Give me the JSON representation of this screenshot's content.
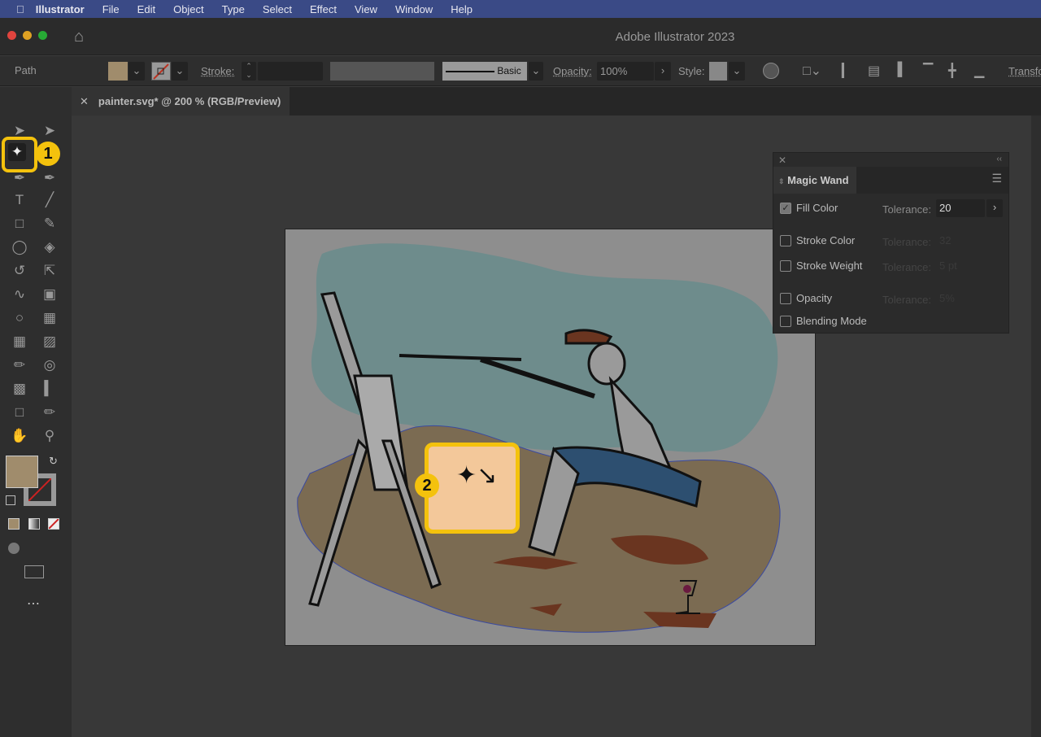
{
  "menubar": {
    "app": "Illustrator",
    "items": [
      "File",
      "Edit",
      "Object",
      "Type",
      "Select",
      "Effect",
      "View",
      "Window",
      "Help"
    ]
  },
  "window": {
    "title": "Adobe Illustrator 2023"
  },
  "control_bar": {
    "selection": "Path",
    "stroke_label": "Stroke:",
    "style_preset": "Basic",
    "opacity_label": "Opacity:",
    "opacity_value": "100%",
    "style_label": "Style:",
    "transform_label": "Transfo"
  },
  "document_tab": {
    "title": "painter.svg* @ 200 % (RGB/Preview)"
  },
  "magic_wand_panel": {
    "title": "Magic Wand",
    "options": [
      {
        "label": "Fill Color",
        "checked": true,
        "tolerance_label": "Tolerance:",
        "tolerance": "20",
        "enabled": true
      },
      {
        "label": "Stroke Color",
        "checked": false,
        "tolerance_label": "Tolerance:",
        "tolerance": "32",
        "enabled": false
      },
      {
        "label": "Stroke Weight",
        "checked": false,
        "tolerance_label": "Tolerance:",
        "tolerance": "5 pt",
        "enabled": false
      },
      {
        "label": "Opacity",
        "checked": false,
        "tolerance_label": "Tolerance:",
        "tolerance": "5%",
        "enabled": false
      },
      {
        "label": "Blending Mode",
        "checked": false
      }
    ]
  },
  "callouts": {
    "one": "1",
    "two": "2"
  },
  "colors": {
    "fill": "#b39f7a",
    "accent": "#f4c20d",
    "menubar": "#3a4a86"
  }
}
